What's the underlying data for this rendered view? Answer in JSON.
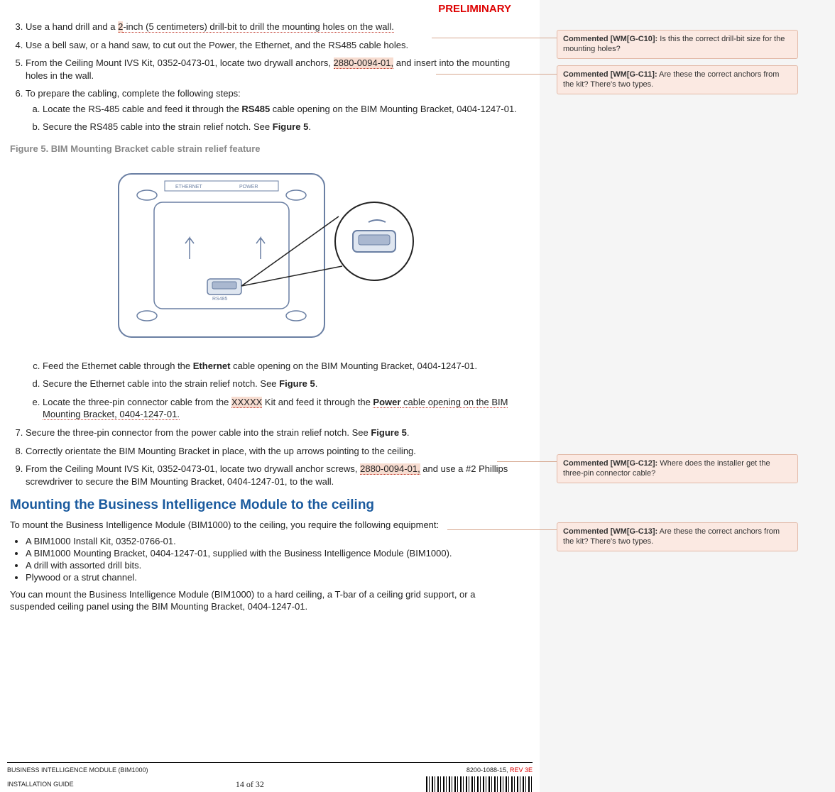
{
  "header": {
    "stamp": "PRELIMINARY"
  },
  "steps": {
    "s3_pre": "Use a hand drill and a ",
    "s3_hl": "2",
    "s3_link": "-inch (5 centimeters) drill-bit to drill the mounting holes on the wall.",
    "s4": "Use a bell saw, or a hand saw, to cut out the Power, the Ethernet, and the RS485 cable holes.",
    "s5_pre": "From the Ceiling Mount IVS Kit, 0352-0473-01, locate two drywall anchors, ",
    "s5_hl": "2880-0094-01,",
    "s5_post": " and insert into the mounting holes in the wall.",
    "s6": "To prepare the cabling, complete the following steps:",
    "s6a_pre": "Locate the RS-485 cable and feed it through the ",
    "s6a_bold": "RS485",
    "s6a_post": " cable opening on the BIM Mounting Bracket, 0404-1247-01.",
    "s6b_pre": "Secure the RS485 cable into the strain relief notch. See ",
    "s6b_bold": "Figure 5",
    "s6b_post": ".",
    "s6c_pre": "Feed the Ethernet cable through the ",
    "s6c_bold": "Ethernet",
    "s6c_post": " cable opening on the BIM Mounting Bracket, 0404-1247-01.",
    "s6d_pre": "Secure the Ethernet cable into the strain relief notch. See ",
    "s6d_bold": "Figure 5",
    "s6d_post": ".",
    "s6e_pre": "Locate the three-pin connector cable from the ",
    "s6e_hl": "XXXXX",
    "s6e_mid": " Kit and feed it through the ",
    "s6e_bold": "Power",
    "s6e_post": " cable opening on the BIM Mounting Bracket, 0404-1247-01.",
    "s7_pre": "Secure the three-pin connector from the power cable into the strain relief notch. See ",
    "s7_bold": "Figure 5",
    "s7_post": ".",
    "s8": "Correctly orientate the BIM Mounting Bracket in place, with the up arrows pointing to the ceiling.",
    "s9_pre": "From the Ceiling Mount IVS Kit, 0352-0473-01, locate two drywall anchor screws, ",
    "s9_hl": "2880-0094-01,",
    "s9_post": " and use a #2 Phillips screwdriver to secure the BIM Mounting Bracket, 0404-1247-01, to the wall."
  },
  "figure": {
    "caption": "Figure 5. BIM Mounting Bracket cable strain relief feature",
    "label_ethernet": "ETHERNET",
    "label_power": "POWER",
    "label_rs485": "RS485"
  },
  "section": {
    "heading": "Mounting the Business Intelligence Module to the ceiling",
    "intro": "To mount the Business Intelligence Module (BIM1000) to the ceiling, you require the following equipment:",
    "bullets": [
      "A BIM1000 Install Kit, 0352-0766-01.",
      "A BIM1000 Mounting Bracket, 0404-1247-01, supplied with the Business Intelligence Module (BIM1000).",
      "A drill with assorted drill bits.",
      "Plywood or a strut channel."
    ],
    "outro": "You can mount the Business Intelligence Module (BIM1000) to a hard ceiling, a T-bar of a ceiling grid support, or a suspended ceiling panel using the BIM Mounting Bracket, 0404-1247-01."
  },
  "comments": {
    "c10": {
      "id": "Commented [WM[G-C10]:",
      "text": " Is this the correct drill-bit size for the mounting holes?"
    },
    "c11": {
      "id": "Commented [WM[G-C11]:",
      "text": " Are these the correct anchors from the kit? There's two types."
    },
    "c12": {
      "id": "Commented [WM[G-C12]:",
      "text": " Where does the installer get the three-pin connector cable?"
    },
    "c13": {
      "id": "Commented [WM[G-C13]:",
      "text": " Are these the correct anchors from the kit? There's two types."
    }
  },
  "footer": {
    "left1": "BUSINESS INTELLIGENCE MODULE (BIM1000)",
    "right1_a": "8200-1088-15, ",
    "right1_b": "REV 3E",
    "left2": "INSTALLATION GUIDE",
    "pagenum": "14 of 32"
  }
}
